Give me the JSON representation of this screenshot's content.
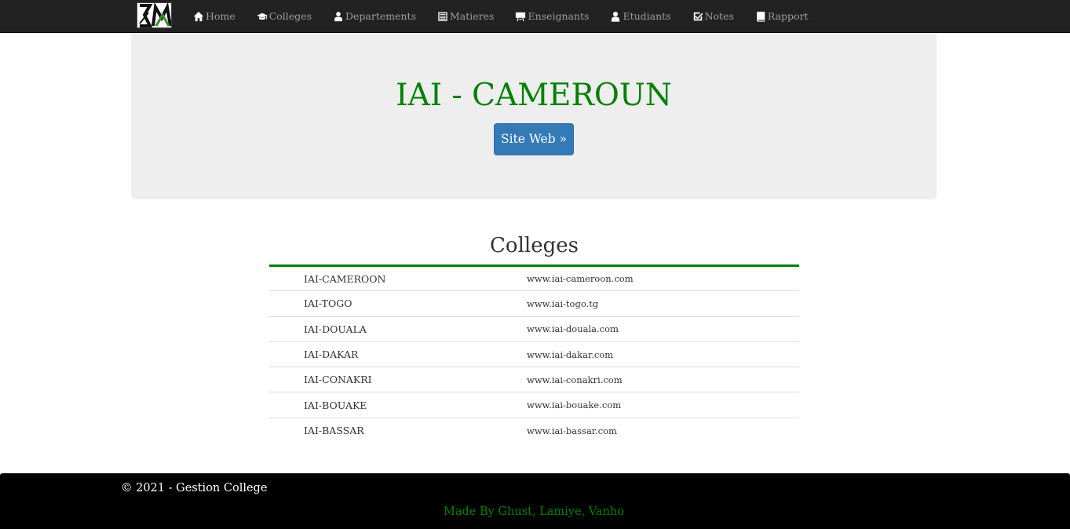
{
  "navbar": {
    "items": [
      {
        "label": "Home",
        "icon": "home-icon"
      },
      {
        "label": "Colleges",
        "icon": "graduation-cap-icon"
      },
      {
        "label": "Departements",
        "icon": "user-icon"
      },
      {
        "label": "Matieres",
        "icon": "list-icon"
      },
      {
        "label": "Enseignants",
        "icon": "blackboard-icon"
      },
      {
        "label": "Etudiants",
        "icon": "user-icon"
      },
      {
        "label": "Notes",
        "icon": "check-icon"
      },
      {
        "label": "Rapport",
        "icon": "book-icon"
      }
    ]
  },
  "jumbotron": {
    "title": "IAI - CAMEROUN",
    "button_label": "Site Web »"
  },
  "colleges": {
    "title": "Colleges",
    "rows": [
      {
        "name": "IAI-CAMEROON",
        "website": "www.iai-cameroon.com"
      },
      {
        "name": "IAI-TOGO",
        "website": "www.iai-togo.tg"
      },
      {
        "name": "IAI-DOUALA",
        "website": "www.iai-douala.com"
      },
      {
        "name": "IAI-DAKAR",
        "website": "www.iai-dakar.com"
      },
      {
        "name": "IAI-CONAKRI",
        "website": "www.iai-conakri.com"
      },
      {
        "name": "IAI-BOUAKE",
        "website": "www.iai-bouake.com"
      },
      {
        "name": "IAI-BASSAR",
        "website": "www.iai-bassar.com"
      }
    ]
  },
  "footer": {
    "copyright": "© 2021 - Gestion College",
    "credits": "Made By Ghust, Lamiye, Vanho"
  },
  "colors": {
    "navbar_bg": "#222222",
    "accent_green": "#008000",
    "button_blue": "#337ab7",
    "jumbotron_bg": "#eeeeee",
    "footer_bg": "#000000"
  }
}
